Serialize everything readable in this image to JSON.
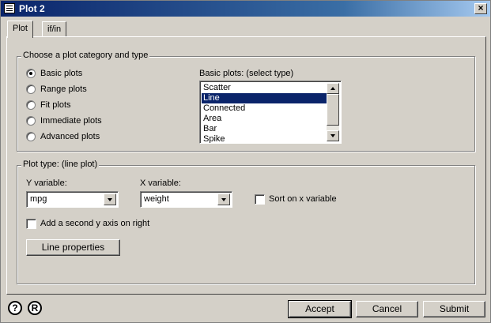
{
  "window": {
    "title": "Plot 2",
    "close_glyph": "×"
  },
  "tabs": [
    {
      "label": "Plot"
    },
    {
      "label": "if/in"
    }
  ],
  "category_group": {
    "legend": "Choose a plot category and type",
    "options": [
      {
        "label": "Basic plots"
      },
      {
        "label": "Range plots"
      },
      {
        "label": "Fit plots"
      },
      {
        "label": "Immediate plots"
      },
      {
        "label": "Advanced plots"
      }
    ],
    "selected": "Basic plots",
    "list_label": "Basic plots: (select type)",
    "list_items": [
      "Scatter",
      "Line",
      "Connected",
      "Area",
      "Bar",
      "Spike"
    ],
    "list_selected": "Line"
  },
  "plot_type_group": {
    "legend": "Plot type: (line plot)",
    "y_label": "Y variable:",
    "y_value": "mpg",
    "x_label": "X variable:",
    "x_value": "weight",
    "sort_label": "Sort on x variable",
    "sort_checked": false,
    "second_axis_label": "Add a second y axis on right",
    "second_axis_checked": false,
    "line_properties_label": "Line properties"
  },
  "footer": {
    "help_glyph": "?",
    "r_glyph": "R",
    "accept_label": "Accept",
    "cancel_label": "Cancel",
    "submit_label": "Submit"
  }
}
